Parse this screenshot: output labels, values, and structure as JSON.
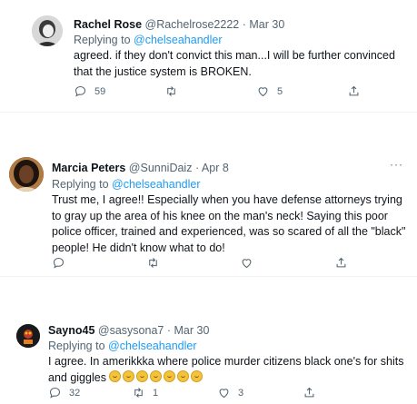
{
  "tweets": [
    {
      "name": "Rachel Rose",
      "handle": "@Rachelrose2222",
      "sep": "·",
      "date": "Mar 30",
      "replying_prefix": "Replying to",
      "replying_to": "@chelseahandler",
      "text": "agreed. if they don't convict this man...I will be further convinced that the justice system is BROKEN.",
      "replies": "59",
      "retweets": "",
      "likes": "5",
      "more": "···"
    },
    {
      "name": "Marcia Peters",
      "handle": "@SunniDaiz",
      "sep": "·",
      "date": "Apr 8",
      "replying_prefix": "Replying to",
      "replying_to": "@chelseahandler",
      "text": "Trust me, I agree!!  Especially when you have defense attorneys trying to gray up the area of his knee on the man's neck!  Saying this poor police officer, trained and experienced, was so scared of all the \"black\" people!  He didn't know what to do!",
      "replies": "",
      "retweets": "",
      "likes": "",
      "more": "···"
    },
    {
      "name": "Sayno45",
      "handle": "@sasysona7",
      "sep": "·",
      "date": "Mar 30",
      "replying_prefix": "Replying to",
      "replying_to": "@chelseahandler",
      "text": "I agree.  In amerikkka where police murder citizens black one's for shits and giggles",
      "emoji_count": 7,
      "replies": "32",
      "retweets": "1",
      "likes": "3",
      "more": ""
    }
  ],
  "icons": [
    "reply-icon",
    "retweet-icon",
    "like-icon",
    "share-icon",
    "more-icon"
  ],
  "colors": {
    "link": "#1d9bf0",
    "muted": "#536471",
    "text": "#0f1419",
    "divider": "#eff3f4"
  }
}
